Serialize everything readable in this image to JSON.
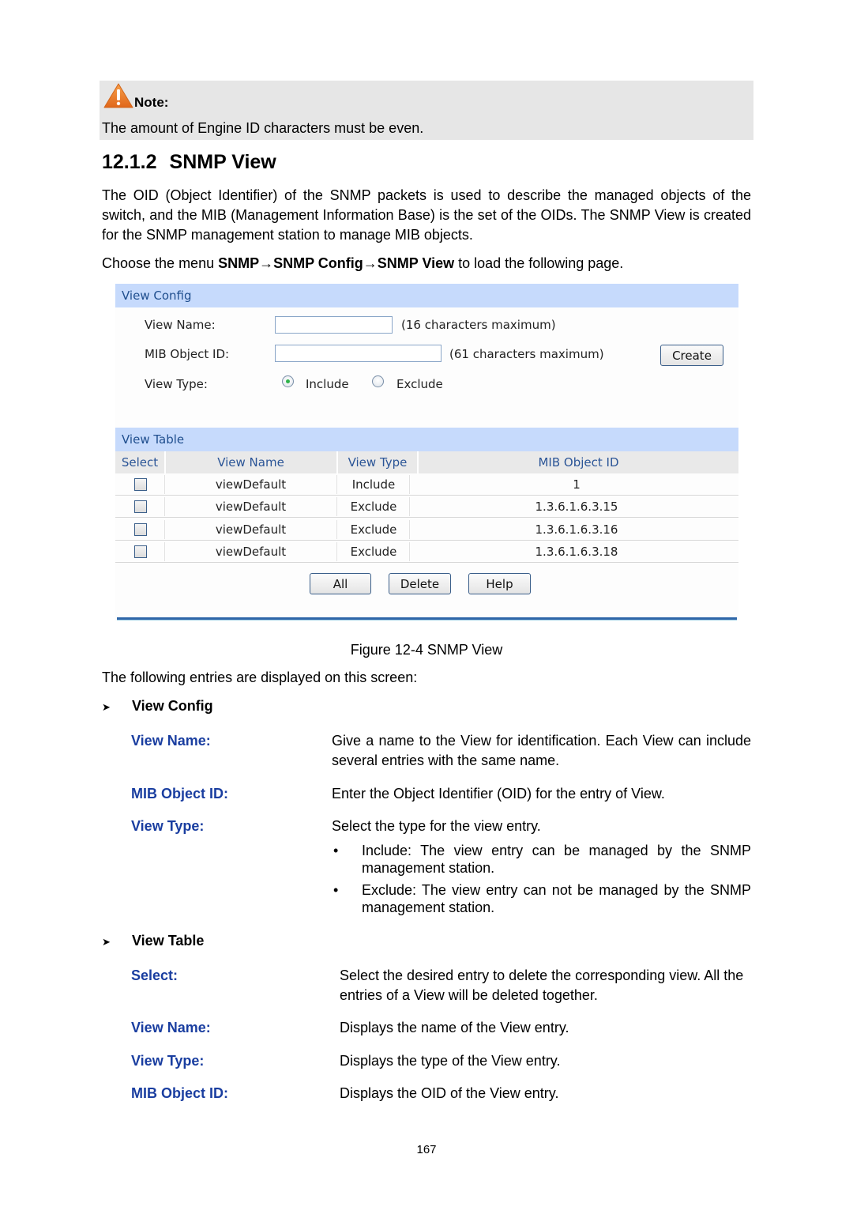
{
  "note": {
    "icon": "warning-triangle-icon",
    "label": "Note:",
    "text": "The amount of Engine ID characters must be even."
  },
  "section": {
    "number": "12.1.2",
    "title": "SNMP View"
  },
  "intro_paragraph": "The OID (Object Identifier) of the SNMP packets is used to describe the managed objects of the switch, and the MIB (Management Information Base) is the set of the OIDs. The SNMP View is created for the SNMP management station to manage MIB objects.",
  "menu_instruction": {
    "prefix": "Choose the menu ",
    "path": "SNMP→SNMP Config→SNMP View",
    "suffix": " to load the following page."
  },
  "figure": {
    "view_config": {
      "header": "View Config",
      "view_name_label": "View Name:",
      "view_name_value": "",
      "view_name_hint": "(16 characters maximum)",
      "mib_object_id_label": "MIB Object ID:",
      "mib_object_id_value": "",
      "mib_object_id_hint": "(61 characters maximum)",
      "view_type_label": "View Type:",
      "view_type_options": [
        "Include",
        "Exclude"
      ],
      "view_type_selected": "Include",
      "create_button": "Create"
    },
    "view_table": {
      "header": "View Table",
      "columns": [
        "Select",
        "View Name",
        "View Type",
        "MIB Object ID"
      ],
      "rows": [
        {
          "selected": false,
          "view_name": "viewDefault",
          "view_type": "Include",
          "mib_object_id": "1"
        },
        {
          "selected": false,
          "view_name": "viewDefault",
          "view_type": "Exclude",
          "mib_object_id": "1.3.6.1.6.3.15"
        },
        {
          "selected": false,
          "view_name": "viewDefault",
          "view_type": "Exclude",
          "mib_object_id": "1.3.6.1.6.3.16"
        },
        {
          "selected": false,
          "view_name": "viewDefault",
          "view_type": "Exclude",
          "mib_object_id": "1.3.6.1.6.3.18"
        }
      ],
      "buttons": {
        "all": "All",
        "delete": "Delete",
        "help": "Help"
      }
    }
  },
  "caption": "Figure 12-4 SNMP View",
  "following_text": "The following entries are displayed on this screen:",
  "view_config_section": {
    "heading": "View Config",
    "entries": [
      {
        "term": "View Name:",
        "description": "Give a name to the View for identification. Each View can include several entries with the same name."
      },
      {
        "term": "MIB Object ID:",
        "description": "Enter the Object Identifier (OID) for the entry of View."
      },
      {
        "term": "View Type:",
        "description": "Select the type for the view entry.",
        "bullets": [
          "Include: The view entry can be managed by the SNMP management station.",
          "Exclude: The view entry can not be managed by the SNMP management station."
        ]
      }
    ]
  },
  "view_table_section": {
    "heading": "View Table",
    "entries": [
      {
        "term": "Select:",
        "description": "Select the desired entry to delete the corresponding view. All the entries of a View will be deleted together."
      },
      {
        "term": "View Name:",
        "description": "Displays the name of the View entry."
      },
      {
        "term": "View Type:",
        "description": "Displays the type of the View entry."
      },
      {
        "term": "MIB Object ID:",
        "description": "Displays the OID of the View entry."
      }
    ]
  },
  "page_number": "167",
  "colors": {
    "term_blue": "#1a3ea0",
    "panel_header_bg": "#c6dafc",
    "panel_header_text": "#1f4e8e",
    "note_bg": "#e6e6e6",
    "warning_orange": "#e8761f"
  }
}
